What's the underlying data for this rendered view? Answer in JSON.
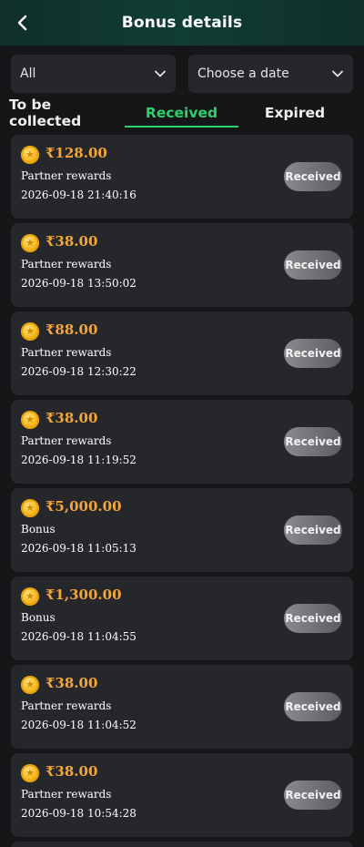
{
  "header": {
    "title": "Bonus details"
  },
  "filters": {
    "type_value": "All",
    "date_value": "Choose a date"
  },
  "tabs": [
    {
      "label": "To be collected"
    },
    {
      "label": "Received"
    },
    {
      "label": "Expired"
    }
  ],
  "colors": {
    "accent": "#2fd06b",
    "amount": "#f5a63a",
    "card": "#25272b",
    "background": "#151618"
  },
  "records": [
    {
      "amount": "₹128.00",
      "type": "Partner rewards",
      "time": "2026-09-18 21:40:16",
      "status": "Received"
    },
    {
      "amount": "₹38.00",
      "type": "Partner rewards",
      "time": "2026-09-18 13:50:02",
      "status": "Received"
    },
    {
      "amount": "₹88.00",
      "type": "Partner rewards",
      "time": "2026-09-18 12:30:22",
      "status": "Received"
    },
    {
      "amount": "₹38.00",
      "type": "Partner rewards",
      "time": "2026-09-18 11:19:52",
      "status": "Received"
    },
    {
      "amount": "₹5,000.00",
      "type": "Bonus",
      "time": "2026-09-18 11:05:13",
      "status": "Received"
    },
    {
      "amount": "₹1,300.00",
      "type": "Bonus",
      "time": "2026-09-18 11:04:55",
      "status": "Received"
    },
    {
      "amount": "₹38.00",
      "type": "Partner rewards",
      "time": "2026-09-18 11:04:52",
      "status": "Received"
    },
    {
      "amount": "₹38.00",
      "type": "Partner rewards",
      "time": "2026-09-18 10:54:28",
      "status": "Received"
    }
  ]
}
